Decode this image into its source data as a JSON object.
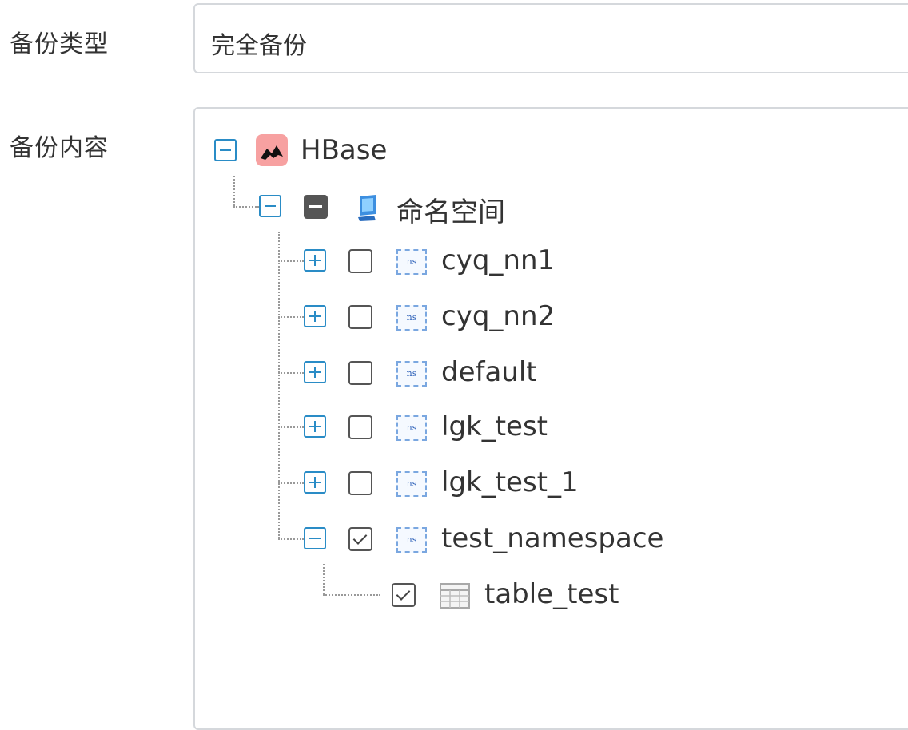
{
  "form": {
    "backup_type_label": "备份类型",
    "backup_type_value": "完全备份",
    "backup_content_label": "备份内容"
  },
  "tree": {
    "root": {
      "label": "HBase",
      "icon": "hbase-icon",
      "expanded": true
    },
    "namespace_group": {
      "label": "命名空间",
      "icon": "namespace-icon",
      "expanded": true,
      "check_state": "partial"
    },
    "namespaces": [
      {
        "label": "cyq_nn1",
        "icon": "ns-icon",
        "icon_text": "ns",
        "expanded": false,
        "checked": false
      },
      {
        "label": "cyq_nn2",
        "icon": "ns-icon",
        "icon_text": "ns",
        "expanded": false,
        "checked": false
      },
      {
        "label": "default",
        "icon": "ns-icon",
        "icon_text": "ns",
        "expanded": false,
        "checked": false
      },
      {
        "label": "lgk_test",
        "icon": "ns-icon",
        "icon_text": "ns",
        "expanded": false,
        "checked": false
      },
      {
        "label": "lgk_test_1",
        "icon": "ns-icon",
        "icon_text": "ns",
        "expanded": false,
        "checked": false
      },
      {
        "label": "test_namespace",
        "icon": "ns-icon",
        "icon_text": "ns",
        "expanded": true,
        "checked": true
      }
    ],
    "tables": [
      {
        "label": "table_test",
        "icon": "table-icon",
        "checked": true
      }
    ]
  },
  "colors": {
    "toggle_accent": "#2a8cc6",
    "hbase_icon_bg": "#f7a1a1",
    "border": "#d5d8dc"
  }
}
